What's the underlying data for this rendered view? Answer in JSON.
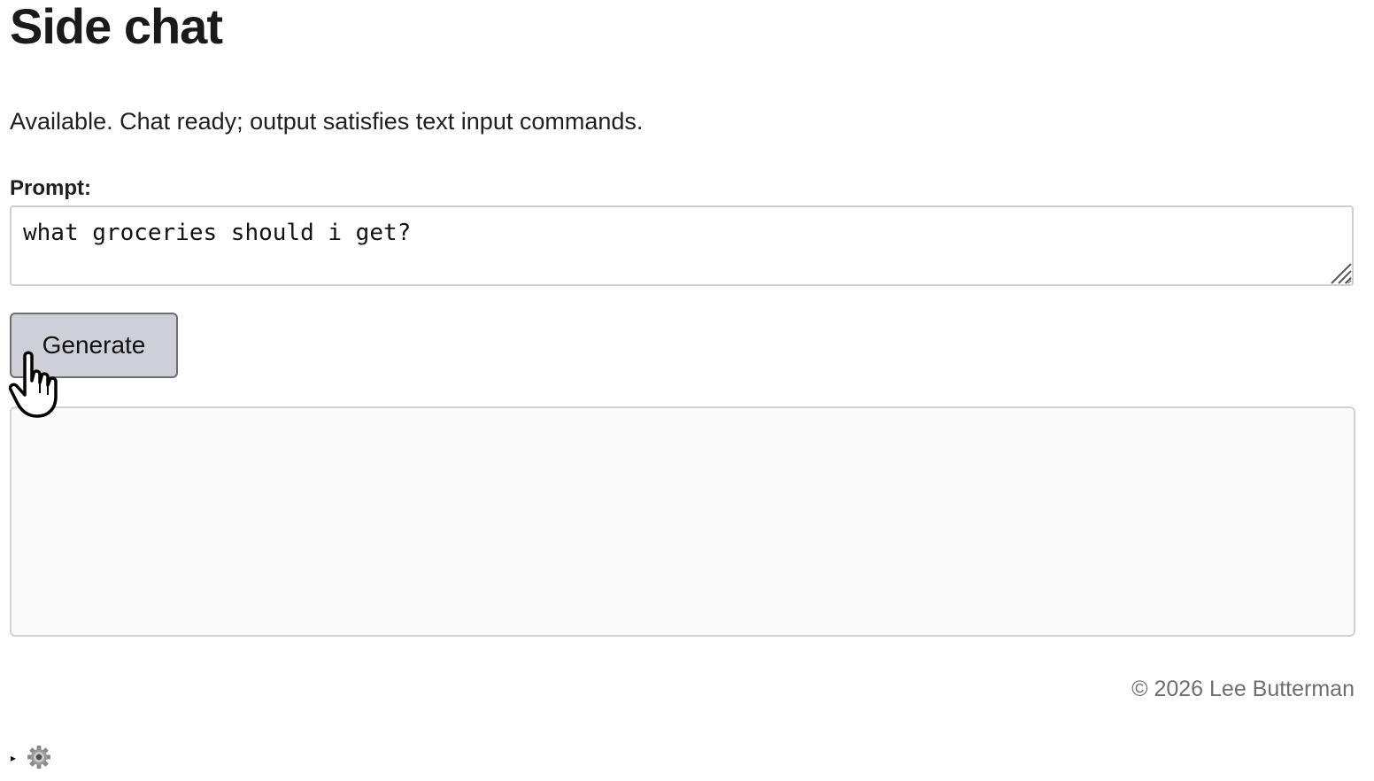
{
  "header": {
    "title": "Side chat"
  },
  "status": {
    "text": "Available. Chat ready; output satisfies text input commands."
  },
  "prompt": {
    "label": "Prompt:",
    "value": "what groceries should i get?"
  },
  "actions": {
    "generate_label": "Generate"
  },
  "output": {
    "text": ""
  },
  "footer": {
    "copyright": "© 2026 Lee Butterman"
  },
  "debug": {
    "toggle_glyph": "▸",
    "icon": "gear-icon"
  },
  "colors": {
    "button_bg": "#cfcfd8",
    "button_border": "#6e6e73",
    "output_bg": "#fafafa",
    "footer_text": "#6f6f6f"
  }
}
